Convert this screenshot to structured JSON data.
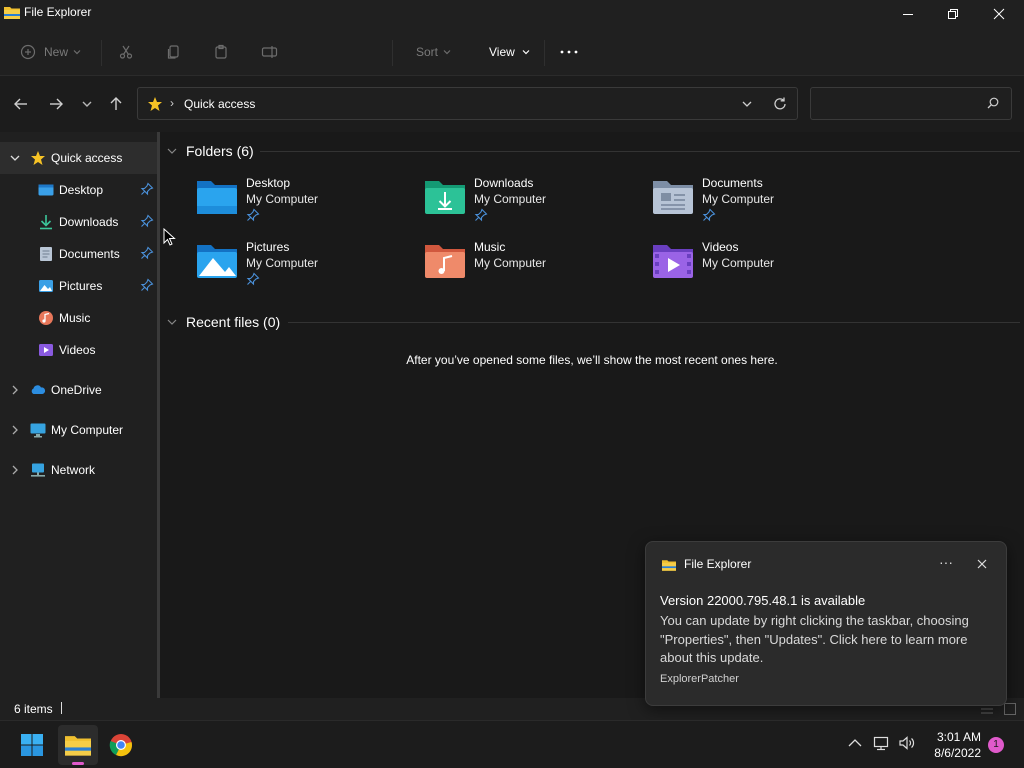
{
  "window": {
    "title": "File Explorer"
  },
  "commandbar": {
    "new_label": "New",
    "sort_label": "Sort",
    "view_label": "View"
  },
  "address": {
    "location": "Quick access",
    "search_placeholder": ""
  },
  "sidebar": {
    "items": [
      {
        "label": "Quick access",
        "icon": "star-icon"
      },
      {
        "label": "Desktop",
        "icon": "desktop-folder-icon",
        "pinned": true
      },
      {
        "label": "Downloads",
        "icon": "download-icon",
        "pinned": true
      },
      {
        "label": "Documents",
        "icon": "documents-icon",
        "pinned": true
      },
      {
        "label": "Pictures",
        "icon": "pictures-icon",
        "pinned": true
      },
      {
        "label": "Music",
        "icon": "music-icon"
      },
      {
        "label": "Videos",
        "icon": "videos-icon"
      },
      {
        "label": "OneDrive",
        "icon": "onedrive-cloud-icon"
      },
      {
        "label": "My Computer",
        "icon": "monitor-icon"
      },
      {
        "label": "Network",
        "icon": "network-icon"
      }
    ]
  },
  "main": {
    "folders_header": "Folders (6)",
    "folders": [
      {
        "name": "Desktop",
        "location": "My Computer",
        "pinned": true
      },
      {
        "name": "Downloads",
        "location": "My Computer",
        "pinned": true
      },
      {
        "name": "Documents",
        "location": "My Computer",
        "pinned": true
      },
      {
        "name": "Pictures",
        "location": "My Computer",
        "pinned": true
      },
      {
        "name": "Music",
        "location": "My Computer",
        "pinned": false
      },
      {
        "name": "Videos",
        "location": "My Computer",
        "pinned": false
      }
    ],
    "recent_header": "Recent files (0)",
    "recent_empty": "After you’ve opened some files, we’ll show the most recent ones here."
  },
  "status": {
    "item_count": "6 items"
  },
  "toast": {
    "app": "File Explorer",
    "more": "···",
    "title": "Version 22000.795.48.1 is available",
    "body": "You can update by right clicking the taskbar, choosing \"Properties\", then \"Updates\". Click here to learn more about this update.",
    "footer": "ExplorerPatcher"
  },
  "taskbar": {
    "time": "3:01 AM",
    "date": "8/6/2022",
    "notification_count": "1"
  },
  "colors": {
    "accent_folder": "#1e90d6",
    "pin": "#4a90d9",
    "badge": "#e05acb"
  }
}
